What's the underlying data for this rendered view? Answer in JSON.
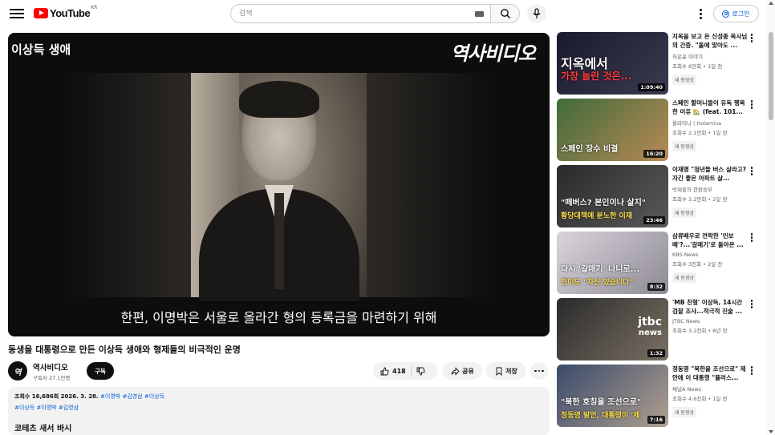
{
  "header": {
    "logo_text": "YouTube",
    "region": "KR",
    "search_placeholder": "검색",
    "signin_label": "로그인"
  },
  "player": {
    "overlay_title": "이상득 생애",
    "overlay_channel": "역사비디오",
    "subtitle": "한편, 이명박은 서울로 올라간 형의 등록금을 마련하기 위해"
  },
  "video": {
    "title": "동생을 대통령으로 만든 이상득 생애와 형제들의 비극적인 운명",
    "channel": "역사비디오",
    "avatar_letter": "역",
    "subscribers": "구독자 27.1만명",
    "subscribe_label": "구독",
    "likes": "418",
    "share_label": "공유",
    "save_label": "저장"
  },
  "description": {
    "views_date": "조회수 16,686회  2026. 3. 28.",
    "tags_line1": "#이명박 #김영삼 #이상득",
    "tags_line2": "#이상득 #이명박 #김영삼",
    "heading": "코테츠 새서 바시"
  },
  "recommendations": [
    {
      "title": "지옥을 보고 온 신성종 목사님의 간증. \"돌에 맞아도 ...",
      "channel": "하은윤 이야기",
      "meta": "조회수 6만회 • 1일 전",
      "badge": "새 동영상",
      "duration": "1:09:40",
      "caption1": "지옥에서",
      "caption2": "가장 놀란 것은...",
      "colors": [
        "#1a1a2e",
        "#3b3b4f"
      ]
    },
    {
      "title": "스페인 할머니들이 유독 행복한 이유 🏡 (feat. 101...",
      "channel": "올라미나 | Holamina",
      "meta": "조회수 2.1만회 • 1일 전",
      "badge": "새 동영상",
      "duration": "16:20",
      "caption1": "스페인 장수 비결",
      "caption2": "",
      "colors": [
        "#3f6b3a",
        "#b98a55"
      ]
    },
    {
      "title": "이재명 \"청년들 버스 살라고? 자긴 좋은 아파트 살...",
      "channel": "박재홍의 한판승부",
      "meta": "조회수 3.2만회 • 2일 전",
      "badge": "새 동영상",
      "duration": "23:46",
      "caption1": "\"떼버스? 본인이나 살지\"",
      "caption2": "황당대책에 분노한 이재",
      "colors": [
        "#2a2a2a",
        "#5a5a5a"
      ]
    },
    {
      "title": "삼류배우로 전락한 '민보배'?...'갈매기'로 돌아온 ...",
      "channel": "KBS News",
      "meta": "조회수 3천회 • 2일 전",
      "badge": "새 동영상",
      "duration": "8:32",
      "caption1": "다시 '갈매기' 나니로...",
      "caption2": "전미도 \"자신 있습니다\"",
      "colors": [
        "#d9d4dc",
        "#8e8a94"
      ]
    },
    {
      "title": "'MB 친형' 이상득, 14시간 검찰 조사...적극적 진술 ...",
      "channel": "JTBC News",
      "meta": "조회수 3.2천회 • 8년 전",
      "badge": "",
      "duration": "1:32",
      "caption1": "jtbc",
      "caption2": "news",
      "colors": [
        "#2b2b2b",
        "#7a7064"
      ]
    },
    {
      "title": "정동영 \"북한을 조선으로\" 제안에 이 대통령 \"플러스...",
      "channel": "채널A News",
      "meta": "조회수 4.6천회 • 1일 전",
      "badge": "새 동영상",
      "duration": "7:16",
      "caption1": "\"북한 호칭을 조선으로\"",
      "caption2": "정동영 발언, 대통령이 '제",
      "colors": [
        "#3a4a6a",
        "#b0a090"
      ]
    }
  ]
}
